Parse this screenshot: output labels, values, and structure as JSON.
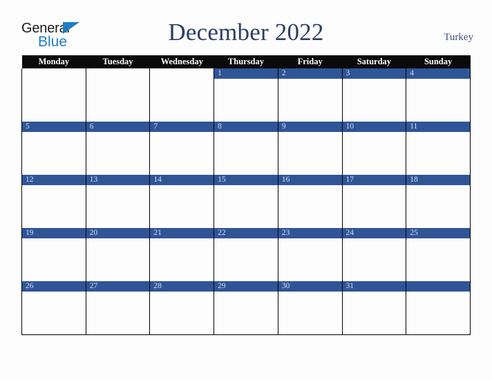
{
  "logo": {
    "word_one": "General",
    "word_two": "Blue",
    "triangle_icon": "triangle-icon",
    "accent_color": "#1f7ec2"
  },
  "header": {
    "title": "December 2022",
    "region": "Turkey",
    "title_color": "#2c3e66",
    "region_color": "#41557f"
  },
  "calendar": {
    "month": "December",
    "year": "2022",
    "weekday_headers": [
      "Monday",
      "Tuesday",
      "Wednesday",
      "Thursday",
      "Friday",
      "Saturday",
      "Sunday"
    ],
    "header_bg": "#0a0a0a",
    "header_text_color": "#ffffff",
    "daybar_bg": "#2f5597",
    "daybar_text_color": "#d9def0",
    "cell_bg": "#fdfdfd",
    "grid_line_color": "#000000",
    "weeks": [
      {
        "days": [
          {
            "label": "",
            "shaded": false
          },
          {
            "label": "",
            "shaded": false
          },
          {
            "label": "",
            "shaded": false
          },
          {
            "label": "1",
            "shaded": true
          },
          {
            "label": "2",
            "shaded": true
          },
          {
            "label": "3",
            "shaded": true
          },
          {
            "label": "4",
            "shaded": true
          }
        ]
      },
      {
        "days": [
          {
            "label": "5",
            "shaded": true
          },
          {
            "label": "6",
            "shaded": true
          },
          {
            "label": "7",
            "shaded": true
          },
          {
            "label": "8",
            "shaded": true
          },
          {
            "label": "9",
            "shaded": true
          },
          {
            "label": "10",
            "shaded": true
          },
          {
            "label": "11",
            "shaded": true
          }
        ]
      },
      {
        "days": [
          {
            "label": "12",
            "shaded": true
          },
          {
            "label": "13",
            "shaded": true
          },
          {
            "label": "14",
            "shaded": true
          },
          {
            "label": "15",
            "shaded": true
          },
          {
            "label": "16",
            "shaded": true
          },
          {
            "label": "17",
            "shaded": true
          },
          {
            "label": "18",
            "shaded": true
          }
        ]
      },
      {
        "days": [
          {
            "label": "19",
            "shaded": true
          },
          {
            "label": "20",
            "shaded": true
          },
          {
            "label": "21",
            "shaded": true
          },
          {
            "label": "22",
            "shaded": true
          },
          {
            "label": "23",
            "shaded": true
          },
          {
            "label": "24",
            "shaded": true
          },
          {
            "label": "25",
            "shaded": true
          }
        ]
      },
      {
        "days": [
          {
            "label": "26",
            "shaded": true
          },
          {
            "label": "27",
            "shaded": true
          },
          {
            "label": "28",
            "shaded": true
          },
          {
            "label": "29",
            "shaded": true
          },
          {
            "label": "30",
            "shaded": true
          },
          {
            "label": "31",
            "shaded": true
          },
          {
            "label": "",
            "shaded": true
          }
        ]
      }
    ]
  }
}
